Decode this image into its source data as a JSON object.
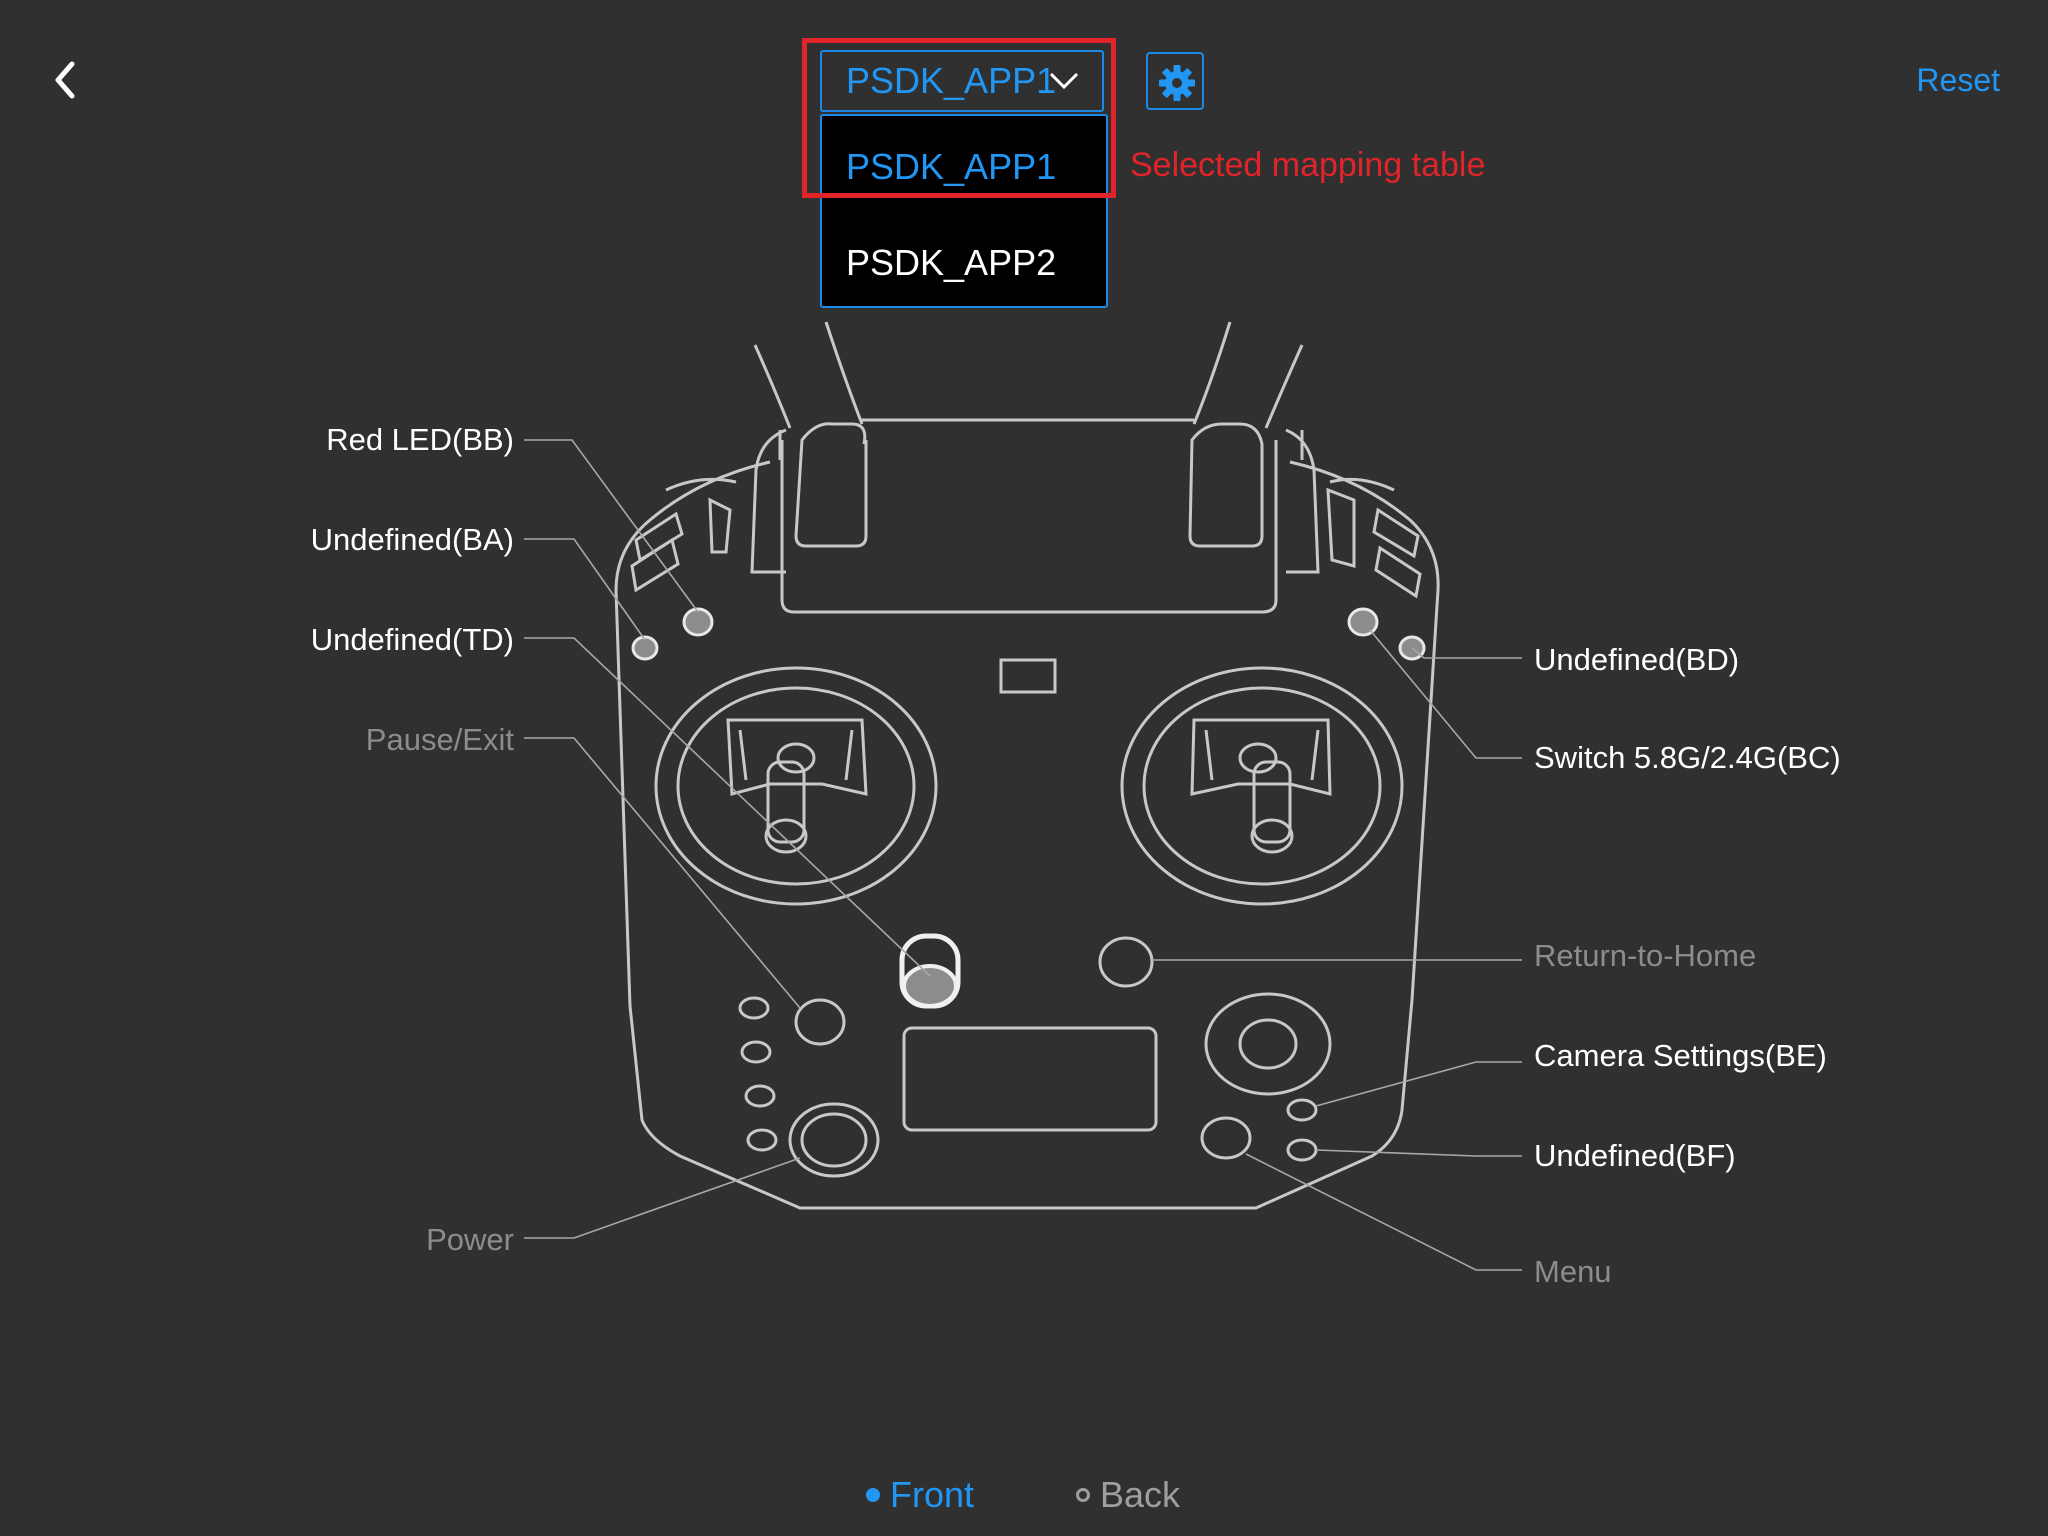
{
  "header": {
    "reset_label": "Reset",
    "back_icon": "chevron-left-icon",
    "settings_icon": "gear-icon",
    "accent_color": "#2196f3"
  },
  "mapping_dropdown": {
    "selected_value": "PSDK_APP1",
    "options": [
      "PSDK_APP1",
      "PSDK_APP2"
    ]
  },
  "annotation": {
    "callout_text": "Selected mapping table",
    "color": "#e0242a"
  },
  "controller_labels": {
    "left": [
      {
        "text": "Red LED(BB)",
        "state": "active"
      },
      {
        "text": "Undefined(BA)",
        "state": "active"
      },
      {
        "text": "Undefined(TD)",
        "state": "active"
      },
      {
        "text": "Pause/Exit",
        "state": "muted"
      },
      {
        "text": "Power",
        "state": "muted"
      }
    ],
    "right": [
      {
        "text": "Undefined(BD)",
        "state": "active"
      },
      {
        "text": "Switch 5.8G/2.4G(BC)",
        "state": "active"
      },
      {
        "text": "Return-to-Home",
        "state": "muted"
      },
      {
        "text": "Camera Settings(BE)",
        "state": "active"
      },
      {
        "text": "Undefined(BF)",
        "state": "active"
      },
      {
        "text": "Menu",
        "state": "muted"
      }
    ]
  },
  "view_tabs": {
    "front_label": "Front",
    "back_label": "Back",
    "active": "Front"
  }
}
